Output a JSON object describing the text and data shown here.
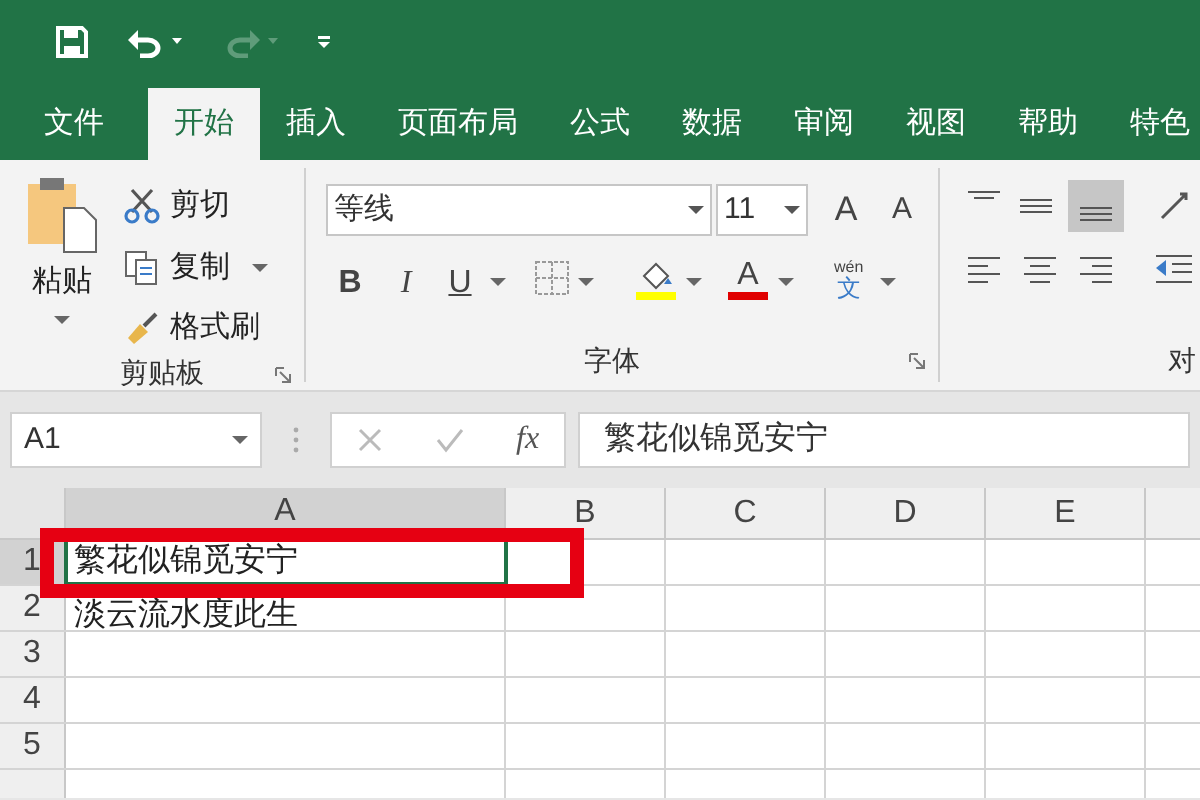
{
  "tabs": [
    {
      "label": "文件",
      "selected": false
    },
    {
      "label": "开始",
      "selected": true
    },
    {
      "label": "插入",
      "selected": false
    },
    {
      "label": "页面布局",
      "selected": false
    },
    {
      "label": "公式",
      "selected": false
    },
    {
      "label": "数据",
      "selected": false
    },
    {
      "label": "审阅",
      "selected": false
    },
    {
      "label": "视图",
      "selected": false
    },
    {
      "label": "帮助",
      "selected": false
    },
    {
      "label": "特色",
      "selected": false
    }
  ],
  "clipboard": {
    "paste": "粘贴",
    "cut": "剪切",
    "copy": "复制",
    "format_painter": "格式刷",
    "label": "剪贴板"
  },
  "font": {
    "name": "等线",
    "size": "11",
    "grow": "A",
    "shrink": "A",
    "bold": "B",
    "italic": "I",
    "underline": "U",
    "font_color": "A",
    "phonetic_top": "wén",
    "phonetic_char": "文",
    "label": "字体"
  },
  "alignment": {
    "label": "对"
  },
  "formula_bar": {
    "name_box": "A1",
    "fx": "fx",
    "value": "繁花似锦觅安宁"
  },
  "sheet": {
    "columns": [
      {
        "label": "A",
        "selected": true
      },
      {
        "label": "B",
        "selected": false
      },
      {
        "label": "C",
        "selected": false
      },
      {
        "label": "D",
        "selected": false
      },
      {
        "label": "E",
        "selected": false
      }
    ],
    "rows": [
      {
        "label": "1",
        "selected": true,
        "cells": [
          "繁花似锦觅安宁"
        ]
      },
      {
        "label": "2",
        "selected": false,
        "cells": [
          "淡云流水度此生"
        ]
      },
      {
        "label": "3",
        "selected": false,
        "cells": []
      },
      {
        "label": "4",
        "selected": false,
        "cells": []
      },
      {
        "label": "5",
        "selected": false,
        "cells": []
      }
    ]
  }
}
